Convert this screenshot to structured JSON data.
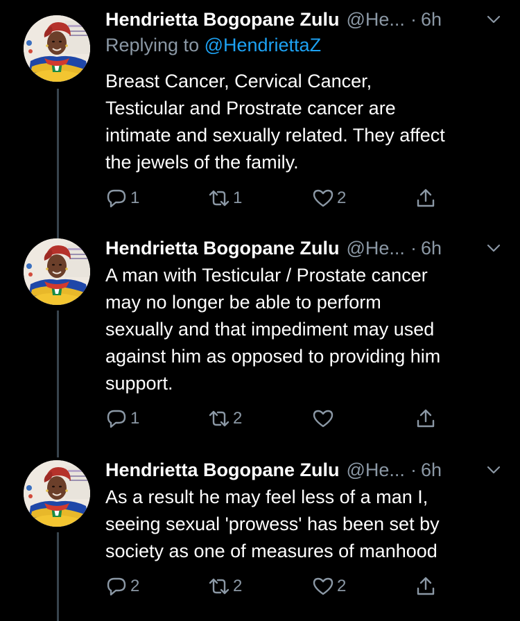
{
  "tweets": [
    {
      "name": "Hendrietta Bogopane Zulu",
      "handle": "@He...",
      "separator": "·",
      "time": "6h",
      "replying_prefix": "Replying to ",
      "replying_to": "@HendriettaZ",
      "lines": [
        "Breast Cancer, Cervical Cancer,",
        "Testicular and Prostrate cancer are",
        "intimate and sexually related. They affect",
        "the jewels of the family."
      ],
      "replies": "1",
      "retweets": "1",
      "likes": "2"
    },
    {
      "name": "Hendrietta Bogopane Zulu",
      "handle": "@He...",
      "separator": "·",
      "time": "6h",
      "lines": [
        "A man with Testicular / Prostate cancer",
        "may no longer be able to perform",
        "sexually and that impediment may used",
        "against him as opposed to providing him",
        "support."
      ],
      "replies": "1",
      "retweets": "2",
      "likes": ""
    },
    {
      "name": "Hendrietta Bogopane Zulu",
      "handle": "@He...",
      "separator": "·",
      "time": "6h",
      "lines": [
        "As a result he may feel less of a man I,",
        "seeing sexual 'prowess' has been set by",
        "society as one of measures of manhood"
      ],
      "replies": "2",
      "retweets": "2",
      "likes": "2"
    }
  ],
  "colors": {
    "background": "#000000",
    "text": "#ffffff",
    "secondary": "#8b98a5",
    "link": "#1da1f2",
    "thread_line": "#38444d"
  },
  "icons": [
    "reply-icon",
    "retweet-icon",
    "like-icon",
    "share-icon",
    "chevron-down-icon"
  ]
}
